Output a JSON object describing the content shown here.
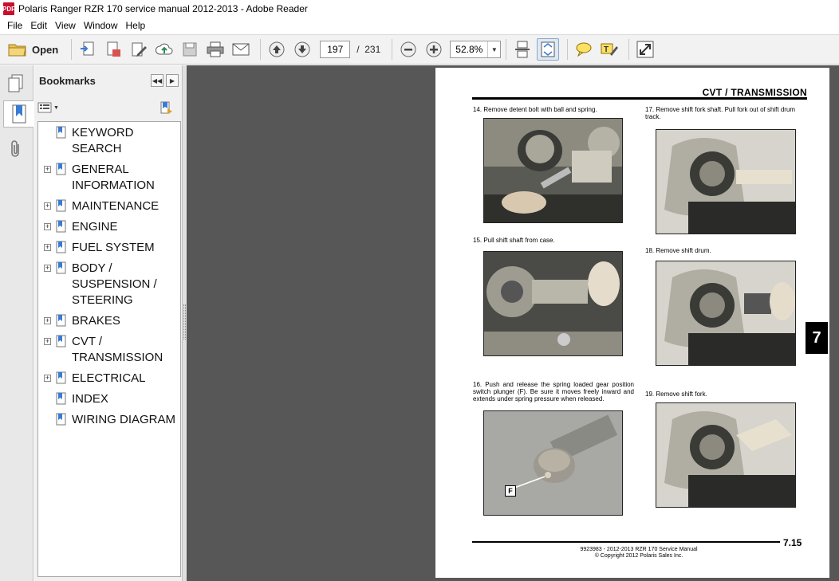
{
  "window": {
    "title": "Polaris Ranger RZR 170 service manual 2012-2013 - Adobe Reader",
    "app_icon_text": "PDF"
  },
  "menu": [
    "File",
    "Edit",
    "View",
    "Window",
    "Help"
  ],
  "toolbar": {
    "open_label": "Open",
    "current_page": "197",
    "page_separator": "/",
    "total_pages": "231",
    "zoom": "52.8%"
  },
  "bookmarks": {
    "title": "Bookmarks",
    "items": [
      {
        "label": "KEYWORD SEARCH",
        "expandable": false
      },
      {
        "label": "GENERAL INFORMATION",
        "expandable": true
      },
      {
        "label": "MAINTENANCE",
        "expandable": true
      },
      {
        "label": "ENGINE",
        "expandable": true
      },
      {
        "label": "FUEL SYSTEM",
        "expandable": true
      },
      {
        "label": "BODY / SUSPENSION / STEERING",
        "expandable": true
      },
      {
        "label": "BRAKES",
        "expandable": true
      },
      {
        "label": "CVT / TRANSMISSION",
        "expandable": true
      },
      {
        "label": "ELECTRICAL",
        "expandable": true
      },
      {
        "label": "INDEX",
        "expandable": false
      },
      {
        "label": "WIRING DIAGRAM",
        "expandable": false
      }
    ]
  },
  "document": {
    "header": "CVT / TRANSMISSION",
    "steps": {
      "s14": "14. Remove detent bolt with ball and spring.",
      "s15": "15. Pull shift shaft from case.",
      "s16": "16. Push and release the spring loaded gear position switch plunger (F). Be sure it moves freely inward and extends under spring pressure when released.",
      "s17": "17. Remove shift fork shaft. Pull fork out of shift drum track.",
      "s18": "18.  Remove shift drum.",
      "s19": "19. Remove shift fork."
    },
    "callout_f": "F",
    "section_tab": "7",
    "footer_line1": "9923983 - 2012-2013 RZR 170 Service Manual",
    "footer_line2": "© Copyright 2012 Polaris Sales Inc.",
    "page_number": "7.15"
  }
}
